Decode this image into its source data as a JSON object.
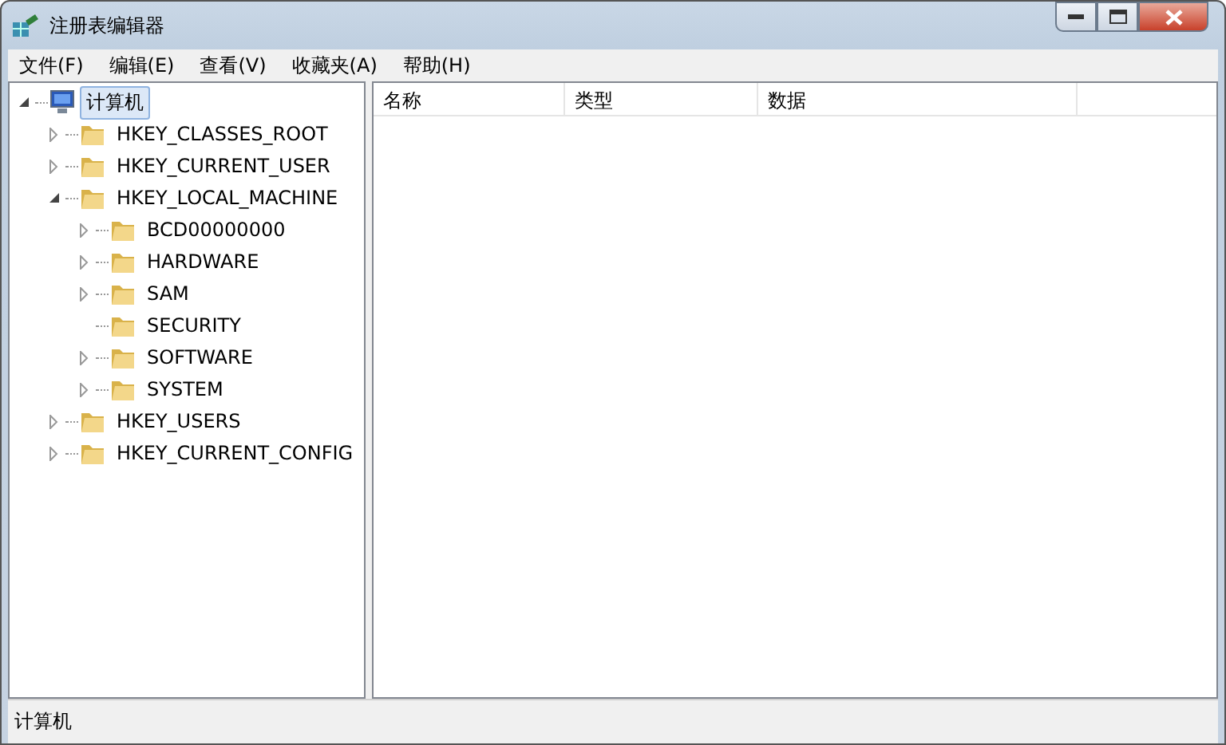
{
  "window": {
    "title": "注册表编辑器"
  },
  "menu": [
    "文件(F)",
    "编辑(E)",
    "查看(V)",
    "收藏夹(A)",
    "帮助(H)"
  ],
  "tree": [
    {
      "label": "计算机",
      "kind": "computer",
      "selected": true,
      "expanded": true,
      "children": [
        {
          "label": "HKEY_CLASSES_ROOT",
          "kind": "folder",
          "selected": false,
          "expanded": false
        },
        {
          "label": "HKEY_CURRENT_USER",
          "kind": "folder",
          "selected": false,
          "expanded": false
        },
        {
          "label": "HKEY_LOCAL_MACHINE",
          "kind": "folder",
          "selected": false,
          "expanded": true,
          "children": [
            {
              "label": "BCD00000000",
              "kind": "folder",
              "selected": false,
              "expanded": false
            },
            {
              "label": "HARDWARE",
              "kind": "folder",
              "selected": false,
              "expanded": false
            },
            {
              "label": "SAM",
              "kind": "folder",
              "selected": false,
              "expanded": false
            },
            {
              "label": "SECURITY",
              "kind": "folder",
              "selected": false
            },
            {
              "label": "SOFTWARE",
              "kind": "folder",
              "selected": false,
              "expanded": false
            },
            {
              "label": "SYSTEM",
              "kind": "folder",
              "selected": false,
              "expanded": false
            }
          ]
        },
        {
          "label": "HKEY_USERS",
          "kind": "folder",
          "selected": false,
          "expanded": false
        },
        {
          "label": "HKEY_CURRENT_CONFIG",
          "kind": "folder",
          "selected": false,
          "expanded": false
        }
      ]
    }
  ],
  "table": {
    "columns": [
      "名称",
      "类型",
      "数据"
    ]
  },
  "status_bar": "计算机"
}
